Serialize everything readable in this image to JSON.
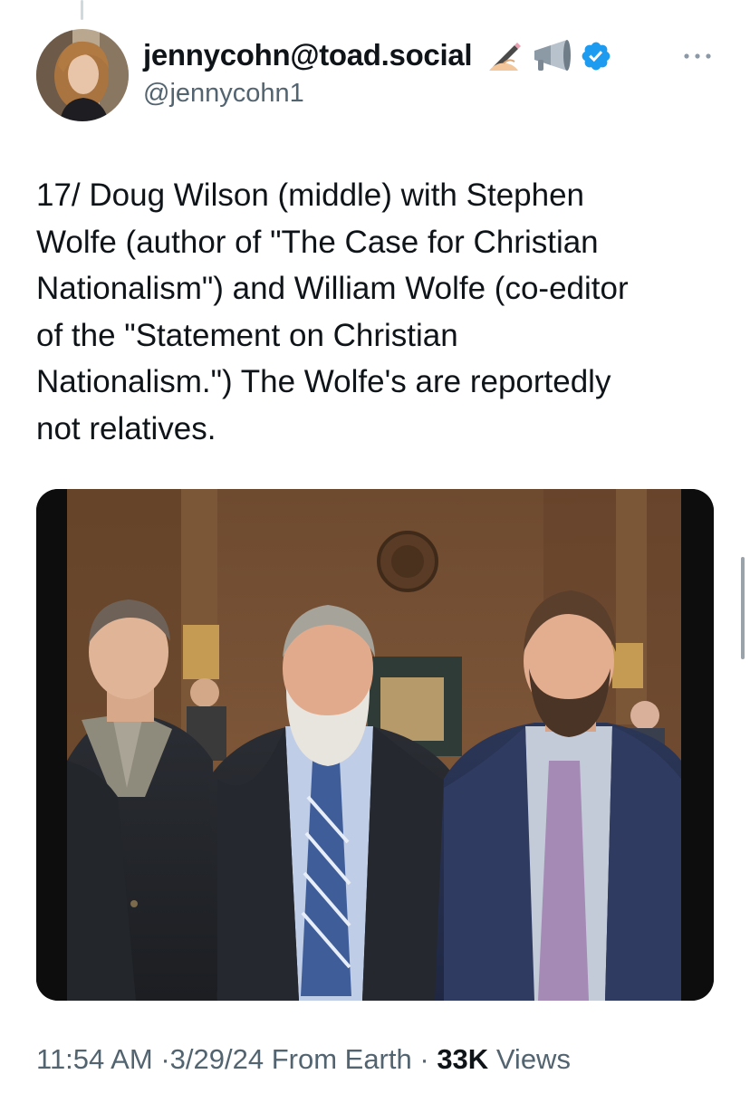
{
  "author": {
    "display_name": "jennycohn@toad.social",
    "handle": "@jennycohn1",
    "badges": [
      "writing-hand-icon",
      "megaphone-icon",
      "verified-badge-icon"
    ],
    "avatar_icon": "avatar-photo"
  },
  "more_icon": "more-options-icon",
  "tweet": {
    "lines": [
      "17/ Doug Wilson (middle) with Stephen",
      "Wolfe (author of \"The Case for Christian",
      "Nationalism\") and William Wolfe (co-editor",
      "of the \"Statement on Christian",
      "Nationalism.\") The Wolfe's are reportedly",
      "not relatives."
    ]
  },
  "media": {
    "type": "photo",
    "subject_icon": "group-photo"
  },
  "meta": {
    "time": "11:54 AM",
    "separator": "·",
    "date": "3/29/24",
    "source": "From Earth",
    "views_count": "33K",
    "views_label": "Views"
  },
  "colors": {
    "text_primary": "#0f1419",
    "text_secondary": "#536471",
    "verified": "#1d9bf0",
    "thread_line": "#cfd9de"
  }
}
